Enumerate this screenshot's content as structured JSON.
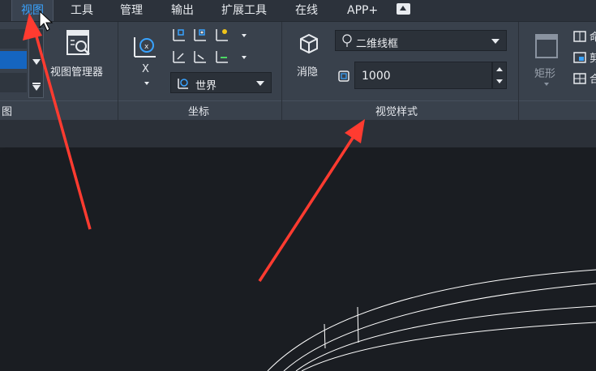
{
  "menu": {
    "tabs": [
      {
        "label": "视图",
        "active": true
      },
      {
        "label": "工具"
      },
      {
        "label": "管理"
      },
      {
        "label": "输出"
      },
      {
        "label": "扩展工具"
      },
      {
        "label": "在线"
      },
      {
        "label": "APP+"
      }
    ]
  },
  "ribbon": {
    "view_panel": {
      "title": "图",
      "view_manager_label": "视图管理器"
    },
    "coordinates_panel": {
      "title": "坐标",
      "x_label": "X",
      "ucs_dropdown_value": "世界"
    },
    "visual_style_panel": {
      "title": "视觉样式",
      "hide_label": "消隐",
      "style_dropdown_value": "二维线框",
      "value_field": "1000"
    },
    "viewport_panel": {
      "rect_label": "矩形",
      "partial_labels": [
        "命",
        "剪",
        "合"
      ]
    }
  },
  "colors": {
    "accent_blue": "#39a3ff",
    "annotation_red": "#ff3b30",
    "drawing_lines": "#ffffff"
  }
}
